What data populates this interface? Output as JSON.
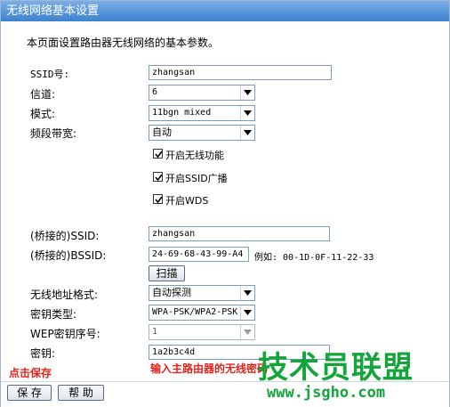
{
  "window": {
    "title": "无线网络基本设置"
  },
  "intro": "本页面设置路由器无线网络的基本参数。",
  "fields": {
    "ssid": {
      "label": "SSID号:",
      "value": "zhangsan"
    },
    "channel": {
      "label": "信道:",
      "value": "6"
    },
    "mode": {
      "label": "模式:",
      "value": "11bgn mixed"
    },
    "bandwidth": {
      "label": "频段带宽:",
      "value": "自动"
    }
  },
  "checkboxes": {
    "wireless": {
      "label": "开启无线功能",
      "checked": true
    },
    "ssid_broadcast": {
      "label": "开启SSID广播",
      "checked": true
    },
    "wds": {
      "label": "开启WDS",
      "checked": true
    }
  },
  "wds": {
    "bridge_ssid": {
      "label": "(桥接的)SSID:",
      "value": "zhangsan"
    },
    "bridge_bssid": {
      "label": "(桥接的)BSSID:",
      "value": "24-69-68-43-99-A4",
      "example": "例如: 00-1D-0F-11-22-33"
    },
    "scan_button": "扫描",
    "address_format": {
      "label": "无线地址格式:",
      "value": "自动探测"
    },
    "key_type": {
      "label": "密钥类型:",
      "value": "WPA-PSK/WPA2-PSK"
    },
    "wep_index": {
      "label": "WEP密钥序号:",
      "value": "1"
    },
    "key": {
      "label": "密钥:",
      "value": "1a2b3c4d"
    }
  },
  "annotations": {
    "click_save": "点击保存",
    "enter_hint": "输入主路由器的无线密码"
  },
  "buttons": {
    "save": "保 存",
    "help": "帮 助"
  },
  "watermark": {
    "text": "技术员联盟",
    "url": "www.jsgho.com"
  },
  "colors": {
    "titlebar": "#3d82d0",
    "annotation_red": "#e0231c",
    "watermark_green": "#12a63a"
  }
}
